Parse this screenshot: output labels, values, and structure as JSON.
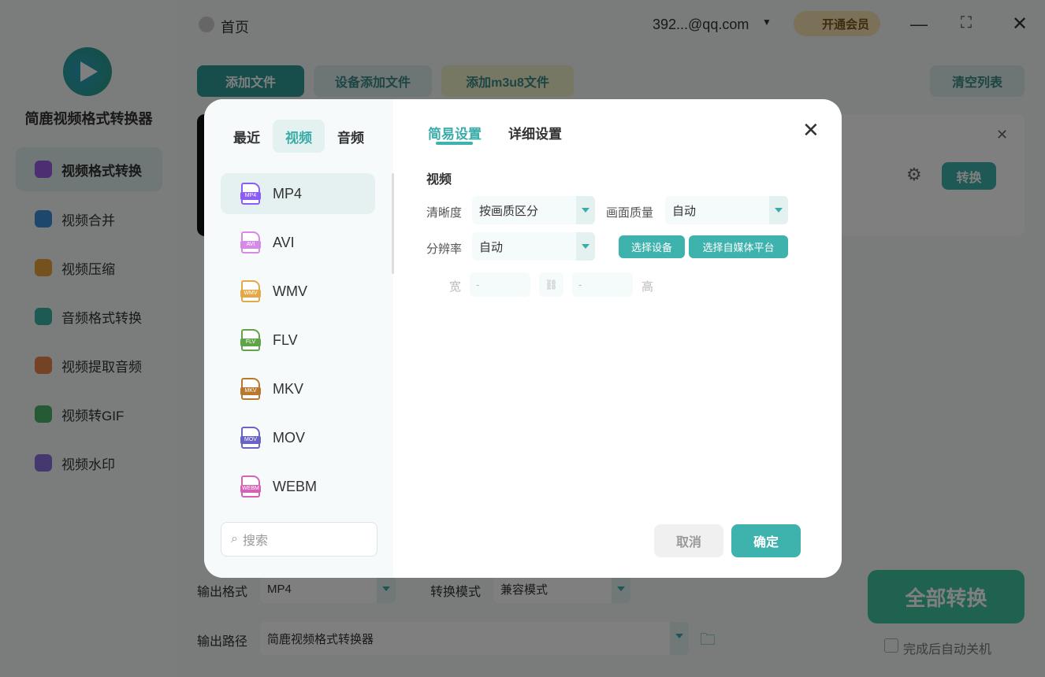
{
  "header": {
    "back_label": "首页",
    "account": "392...@qq.com",
    "vip_label": "开通会员"
  },
  "sidebar": {
    "app_name": "简鹿视频格式转换器",
    "items": [
      {
        "label": "视频格式转换",
        "color": "#9b5de5"
      },
      {
        "label": "视频合并",
        "color": "#3a8fd9"
      },
      {
        "label": "视频压缩",
        "color": "#e8a23a"
      },
      {
        "label": "音频格式转换",
        "color": "#3ab5a8"
      },
      {
        "label": "视频提取音频",
        "color": "#e8874a"
      },
      {
        "label": "视频转GIF",
        "color": "#4bb56a"
      },
      {
        "label": "视频水印",
        "color": "#8a6ee0"
      }
    ]
  },
  "toolbar": {
    "add_file": "添加文件",
    "device_add": "设备添加文件",
    "add_m3u8": "添加m3u8文件",
    "clear_list": "清空列表"
  },
  "file_item": {
    "convert": "转换"
  },
  "bottom": {
    "output_format_label": "输出格式",
    "output_format": "MP4",
    "mode_label": "转换模式",
    "mode": "兼容模式",
    "output_path_label": "输出路径",
    "output_path": "简鹿视频格式转换器",
    "convert_all": "全部转换",
    "auto_shutdown": "完成后自动关机"
  },
  "modal": {
    "categories": [
      "最近",
      "视频",
      "音频"
    ],
    "formats": [
      {
        "name": "MP4",
        "color": "#8b5cf6"
      },
      {
        "name": "AVI",
        "color": "#d58be6"
      },
      {
        "name": "WMV",
        "color": "#e3a848"
      },
      {
        "name": "FLV",
        "color": "#5ea54a"
      },
      {
        "name": "MKV",
        "color": "#b8782e"
      },
      {
        "name": "MOV",
        "color": "#6a64c4"
      },
      {
        "name": "WEBM",
        "color": "#d463b8"
      }
    ],
    "search_placeholder": "搜索",
    "tabs": [
      "简易设置",
      "详细设置"
    ],
    "section": "视频",
    "clarity_label": "清晰度",
    "clarity": "按画质区分",
    "quality_label": "画面质量",
    "quality": "自动",
    "resolution_label": "分辨率",
    "resolution": "自动",
    "select_device": "选择设备",
    "select_platform": "选择自媒体平台",
    "width_label": "宽",
    "width": "-",
    "height_label": "高",
    "height": "-",
    "cancel": "取消",
    "ok": "确定",
    "accent": "#3eb2ad"
  }
}
